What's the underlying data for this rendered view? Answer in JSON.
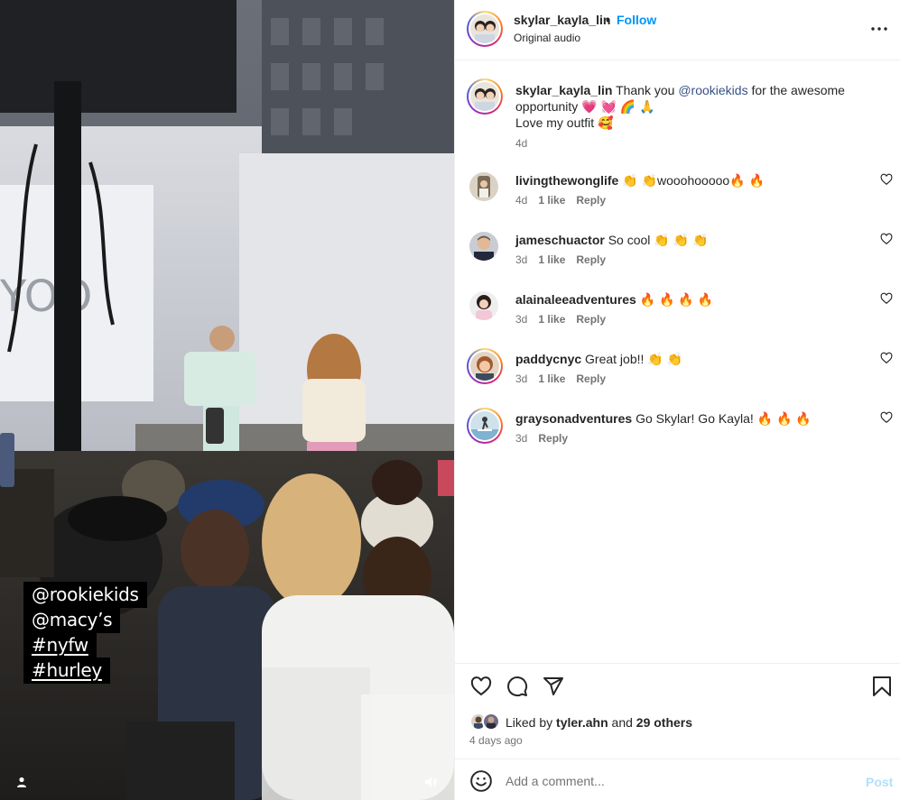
{
  "media": {
    "overlay_tags": [
      "@rookiekids",
      "@macy’s",
      "#nyfw",
      "#hurley"
    ],
    "user_icon": "person-icon",
    "sound_icon": "speaker-icon"
  },
  "header": {
    "username": "skylar_kayla_lin",
    "separator": "•",
    "follow_label": "Follow",
    "audio_label": "Original audio",
    "more_icon": "more-horizontal-icon"
  },
  "caption": {
    "username": "skylar_kayla_lin",
    "text_before": "Thank you",
    "mention": "@rookiekids",
    "text_after": "for the awesome opportunity 💗 💓 🌈 🙏",
    "line2": "Love my outfit 🥰",
    "time": "4d"
  },
  "comments": [
    {
      "username": "livingthewonglife",
      "text": "👏 👏wooohooooo🔥 🔥",
      "time": "4d",
      "likes": "1 like",
      "reply": "Reply"
    },
    {
      "username": "jameschuactor",
      "text": "So cool 👏 👏 👏",
      "time": "3d",
      "likes": "1 like",
      "reply": "Reply"
    },
    {
      "username": "alainaleeadventures",
      "text": "🔥 🔥 🔥 🔥",
      "time": "3d",
      "likes": "1 like",
      "reply": "Reply"
    },
    {
      "username": "paddycnyc",
      "text": "Great job!! 👏 👏",
      "time": "3d",
      "likes": "1 like",
      "reply": "Reply"
    },
    {
      "username": "graysonadventures",
      "text": "Go Skylar! Go Kayla! 🔥 🔥 🔥",
      "time": "3d",
      "likes": "",
      "reply": "Reply"
    }
  ],
  "actions": {
    "like_icon": "heart-icon",
    "comment_icon": "comment-icon",
    "share_icon": "share-icon",
    "save_icon": "bookmark-icon"
  },
  "likes": {
    "prefix": "Liked by",
    "user": "tyler.ahn",
    "and": "and",
    "others": "29 others"
  },
  "post_date": "4 days ago",
  "add_comment": {
    "placeholder": "Add a comment...",
    "post_label": "Post",
    "emoji_icon": "smiley-icon"
  },
  "colors": {
    "accent": "#0095f6",
    "mention": "#385185",
    "post_disabled": "#b2dffc",
    "secondary_text": "#737373"
  }
}
